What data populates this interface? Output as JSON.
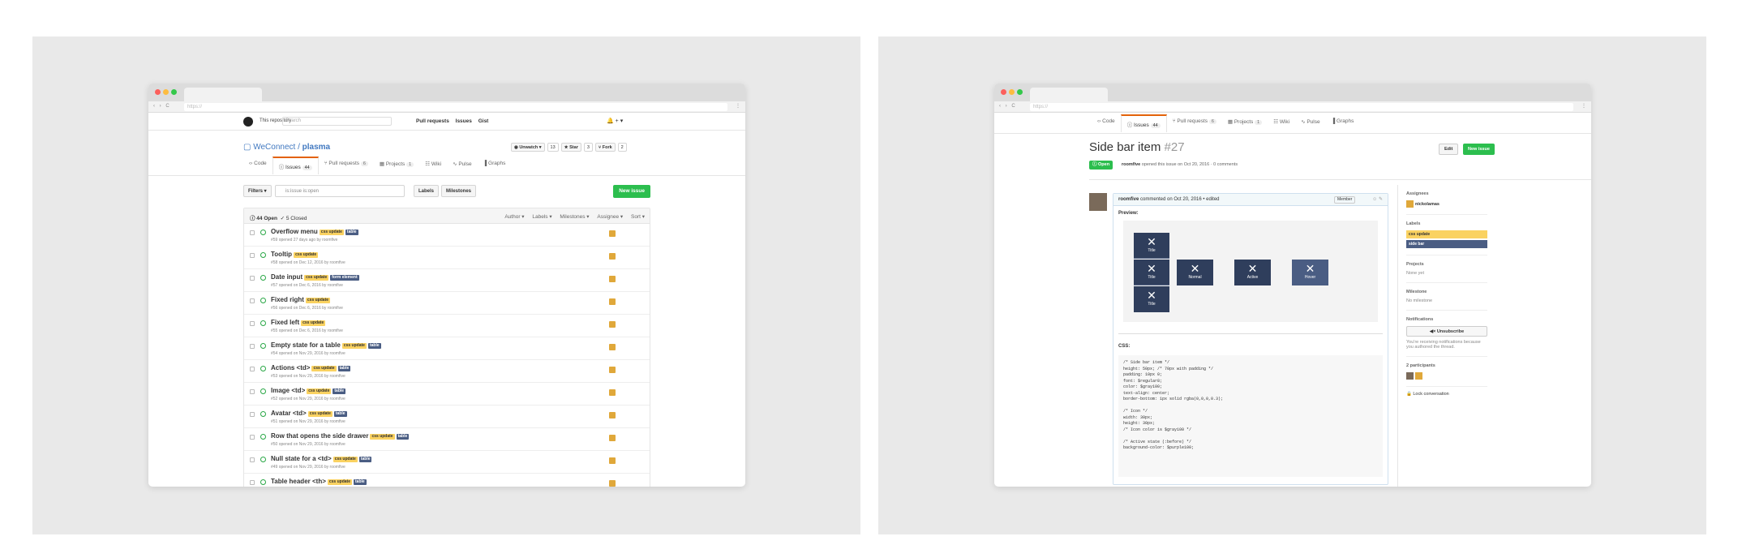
{
  "left": {
    "url": "https://",
    "header": {
      "repo_label": "This repository",
      "search_placeholder": "Search",
      "nav": [
        "Pull requests",
        "Issues",
        "Gist"
      ],
      "icons": "🔔 + ▾"
    },
    "repo": {
      "owner": "WeConnect",
      "sep": " / ",
      "name": "plasma"
    },
    "repo_buttons": [
      {
        "label": "◉ Unwatch ▾",
        "count": "13"
      },
      {
        "label": "★ Star",
        "count": "3"
      },
      {
        "label": "⑂ Fork",
        "count": "2"
      }
    ],
    "tabs": [
      {
        "label": "‹› Code"
      },
      {
        "label": "ⓘ Issues",
        "count": "44"
      },
      {
        "label": "⑂ Pull requests",
        "count": "6"
      },
      {
        "label": "▦ Projects",
        "count": "1"
      },
      {
        "label": "☷ Wiki"
      },
      {
        "label": "∿ Pulse"
      },
      {
        "label": "▐ Graphs"
      }
    ],
    "filters": {
      "button": "Filters ▾",
      "query": "is:issue is:open",
      "labels": "Labels",
      "milestones": "Milestones",
      "new_issue": "New issue"
    },
    "list_head": {
      "open": "ⓘ 44 Open",
      "closed": "✓ 5 Closed",
      "cols": [
        "Author ▾",
        "Labels ▾",
        "Milestones ▾",
        "Assignee ▾",
        "Sort ▾"
      ]
    },
    "issues": [
      {
        "title": "Overflow menu",
        "labels": [
          "css update",
          "table"
        ],
        "meta": "#59 opened 27 days ago by roomfive"
      },
      {
        "title": "Tooltip",
        "labels": [
          "css update"
        ],
        "meta": "#58 opened on Dec 12, 2016 by roomfive"
      },
      {
        "title": "Date input",
        "labels": [
          "css update",
          "form element"
        ],
        "meta": "#57 opened on Dec 6, 2016 by roomfive"
      },
      {
        "title": "Fixed right",
        "labels": [
          "css update"
        ],
        "meta": "#56 opened on Dec 6, 2016 by roomfive"
      },
      {
        "title": "Fixed left",
        "labels": [
          "css update"
        ],
        "meta": "#55 opened on Dec 6, 2016 by roomfive"
      },
      {
        "title": "Empty state for a table",
        "labels": [
          "css update",
          "table"
        ],
        "meta": "#54 opened on Nov 29, 2016 by roomfive"
      },
      {
        "title": "Actions <td>",
        "labels": [
          "css update",
          "table"
        ],
        "meta": "#53 opened on Nov 29, 2016 by roomfive"
      },
      {
        "title": "Image <td>",
        "labels": [
          "css update",
          "table"
        ],
        "meta": "#52 opened on Nov 29, 2016 by roomfive"
      },
      {
        "title": "Avatar <td>",
        "labels": [
          "css update",
          "table"
        ],
        "meta": "#51 opened on Nov 29, 2016 by roomfive"
      },
      {
        "title": "Row that opens the side drawer",
        "labels": [
          "css update",
          "table"
        ],
        "meta": "#50 opened on Nov 29, 2016 by roomfive"
      },
      {
        "title": "Null state for a <td>",
        "labels": [
          "css update",
          "table"
        ],
        "meta": "#49 opened on Nov 29, 2016 by roomfive"
      },
      {
        "title": "Table header <th>",
        "labels": [
          "css update",
          "table"
        ],
        "meta": ""
      }
    ]
  },
  "right": {
    "url": "https://",
    "tabs": [
      {
        "label": "‹› Code"
      },
      {
        "label": "ⓘ Issues",
        "count": "44"
      },
      {
        "label": "⑂ Pull requests",
        "count": "6"
      },
      {
        "label": "▦ Projects",
        "count": "1"
      },
      {
        "label": "☷ Wiki"
      },
      {
        "label": "∿ Pulse"
      },
      {
        "label": "▐ Graphs"
      }
    ],
    "issue": {
      "title": "Side bar item",
      "number": "#27",
      "edit": "Edit",
      "new_issue": "New issue",
      "state": "ⓘ Open",
      "author": "roomfive",
      "opened": " opened this issue on Oct 20, 2016 · 0 comments"
    },
    "comment": {
      "author": "roomfive",
      "meta": " commented on Oct 20, 2016 • edited",
      "badge": "Member",
      "icons": "☺ ✎",
      "preview_label": "Preview:",
      "items": [
        {
          "icon": "✕",
          "label": "Title"
        },
        {
          "icon": "✕",
          "label": "Title"
        },
        {
          "icon": "✕",
          "label": "Title"
        },
        {
          "icon": "✕",
          "label": "Normal"
        },
        {
          "icon": "✕",
          "label": "Active"
        },
        {
          "icon": "✕",
          "label": "Hover"
        }
      ],
      "css_label": "CSS:",
      "code": "/* Side bar item */\nheight: 50px; /* 70px with padding */\npadding: 10px 0;\nfont: $regular8;\ncolor: $gray100;\ntext-align: center;\nborder-bottom: 1px solid rgba(0,0,0,0.3);\n\n/* Icon */\nwidth: 30px;\nheight: 30px;\n/* Icon color is $gray100 */\n\n/* Active state (:before) */\nbackground-color: $purple100;"
    },
    "sidebar": {
      "assignees_title": "Assignees",
      "assignee": "nickolamas",
      "labels_title": "Labels",
      "labels": [
        {
          "name": "css update",
          "color": "#fad261"
        },
        {
          "name": "side bar",
          "color": "#4a5d83"
        }
      ],
      "projects_title": "Projects",
      "projects_value": "None yet",
      "milestone_title": "Milestone",
      "milestone_value": "No milestone",
      "notifications_title": "Notifications",
      "unsubscribe": "◀× Unsubscribe",
      "notif_text": "You're receiving notifications because you authored the thread.",
      "participants": "2 participants",
      "lock": "🔒 Lock conversation"
    }
  }
}
